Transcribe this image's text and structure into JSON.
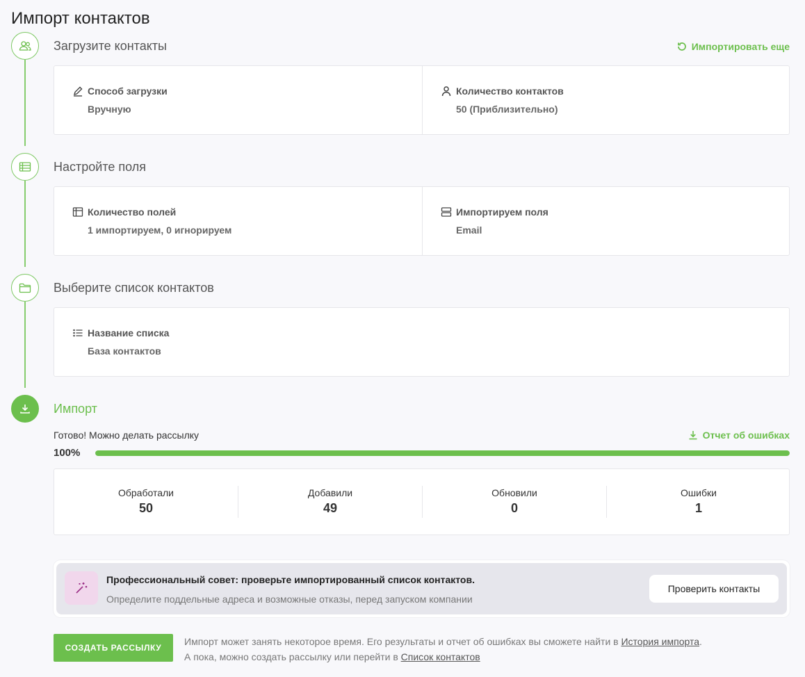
{
  "page_title": "Импорт контактов",
  "steps": [
    {
      "title": "Загрузите контакты",
      "icon": "users-icon"
    },
    {
      "title": "Настройте поля",
      "icon": "table-icon"
    },
    {
      "title": "Выберите список контактов",
      "icon": "folder-icon"
    },
    {
      "title": "Импорт",
      "icon": "download-icon"
    }
  ],
  "import_more_label": "Импортировать еще",
  "upload": {
    "method_label": "Способ загрузки",
    "method_value": "Вручную",
    "count_label": "Количество контактов",
    "count_value": "50 (Приблизительно)"
  },
  "fields": {
    "count_label": "Количество полей",
    "count_value": "1 импортируем, 0 игнорируем",
    "imported_label": "Импортируем поля",
    "imported_value": "Email"
  },
  "list": {
    "name_label": "Название списка",
    "name_value": "База контактов"
  },
  "import": {
    "status": "Готово! Можно делать рассылку",
    "error_report_label": "Отчет об ошибках",
    "percent_text": "100%",
    "progress": 1.0
  },
  "stats": [
    {
      "label": "Обработали",
      "value": "50"
    },
    {
      "label": "Добавили",
      "value": "49"
    },
    {
      "label": "Обновили",
      "value": "0"
    },
    {
      "label": "Ошибки",
      "value": "1"
    }
  ],
  "tip": {
    "title": "Профессиональный совет: проверьте импортированный список контактов.",
    "subtitle": "Определите поддельные адреса и возможные отказы, перед запуском компании",
    "button_label": "Проверить контакты"
  },
  "footer": {
    "create_button": "СОЗДАТЬ РАССЫЛКУ",
    "note_line1": "Импорт может занять некоторое время. Его результаты и отчет об ошибках вы сможете найти в ",
    "history_link": "История импорта",
    "note_line1_end": ".",
    "note_line2": "А пока, можно создать рассылку или перейти в ",
    "contacts_link": "Список контактов"
  },
  "colors": {
    "accent": "#6cbf4d",
    "tip_icon_bg": "#f1d7ec",
    "tip_icon": "#9b2f86"
  }
}
